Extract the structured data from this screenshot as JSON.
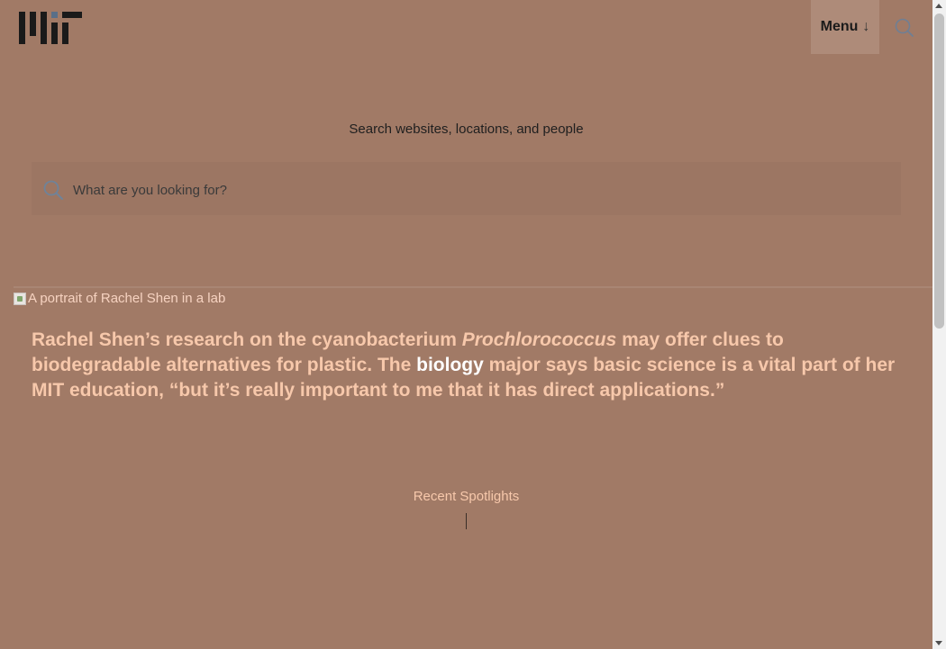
{
  "header": {
    "logo_text": "MIT",
    "menu_label": "Menu",
    "menu_arrow": "↓",
    "search_icon": "search-icon"
  },
  "search": {
    "heading": "Search websites, locations, and people",
    "placeholder": "What are you looking for?",
    "icon": "search-icon"
  },
  "hero": {
    "image_alt": "A portrait of Rachel Shen in a lab",
    "text_part1": "Rachel Shen’s research on the cyanobacterium ",
    "text_italic": "Prochlorococcus",
    "text_part2": " may offer clues to biodegradable alternatives for plastic. The ",
    "link_text": "biology",
    "text_part3": " major says basic science is a vital part of her MIT education, “but it’s really important to me that it has direct applications.”"
  },
  "recent": {
    "label": "Recent Spotlights"
  },
  "colors": {
    "background": "#a17a66",
    "accent_text": "#f7c8ab",
    "link": "#ffffff"
  }
}
